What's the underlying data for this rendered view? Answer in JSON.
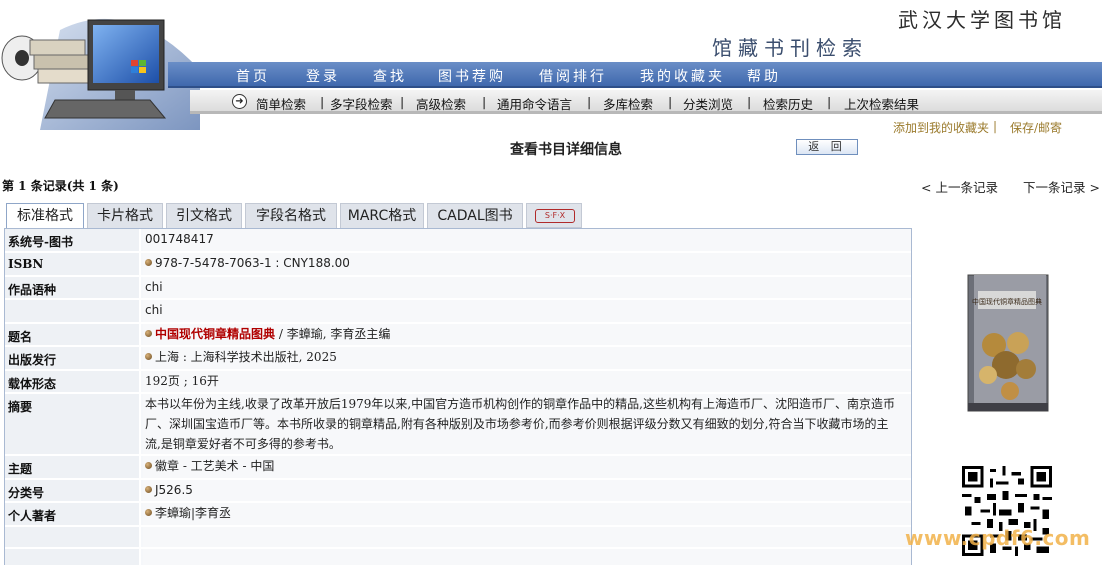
{
  "header": {
    "library_title": "武汉大学图书馆",
    "system_title": "馆藏书刊检索"
  },
  "nav": {
    "items": [
      "首页",
      "登录",
      "查找",
      "图书荐购",
      "借阅排行",
      "我的收藏夹",
      "帮助"
    ]
  },
  "subnav": {
    "items": [
      "简单检索",
      "多字段检索",
      "高级检索",
      "通用命令语言",
      "多库检索",
      "分类浏览",
      "检索历史",
      "上次检索结果"
    ]
  },
  "actions": {
    "add_favorite": "添加到我的收藏夹",
    "save_mail": "保存/邮寄"
  },
  "page": {
    "heading": "查看书目详细信息",
    "back_label": "返 回",
    "record_count": "第 1 条记录(共 1 条)",
    "prev": "< 上一条记录",
    "next": "下一条记录 >"
  },
  "tabs": [
    "标准格式",
    "卡片格式",
    "引文格式",
    "字段名格式",
    "MARC格式",
    "CADAL图书"
  ],
  "sfx_label": "S·F·X",
  "record": {
    "system_no_label": "系统号-图书",
    "system_no": "001748417",
    "isbn_label": "ISBN",
    "isbn": "978-7-5478-7063-1 : CNY188.00",
    "lang_label": "作品语种",
    "lang1": "chi",
    "lang2": "chi",
    "title_label": "题名",
    "title": "中国现代铜章精品图典",
    "title_resp": " / 李蟑瑜, 李育丞主编",
    "publish_label": "出版发行",
    "publish": "上海 : 上海科学技术出版社, 2025",
    "physical_label": "载体形态",
    "physical": "192页 ; 16开",
    "abstract_label": "摘要",
    "abstract": "本书以年份为主线,收录了改革开放后1979年以来,中国官方造币机构创作的铜章作品中的精品,这些机构有上海造币厂、沈阳造币厂、南京造币厂、深圳国宝造币厂等。本书所收录的铜章精品,附有各种版别及市场参考价,而参考价则根据评级分数又有细致的划分,符合当下收藏市场的主流,是铜章爱好者不可多得的参考书。",
    "subject_label": "主题",
    "subject": "徽章 - 工艺美术 - 中国",
    "class_label": "分类号",
    "class_no": "J526.5",
    "author_label": "个人著者",
    "author": "李蟑瑜|李育丞"
  },
  "cover": {
    "title": "中国现代铜章精品图典"
  },
  "watermark": "www.cpdf6.com"
}
